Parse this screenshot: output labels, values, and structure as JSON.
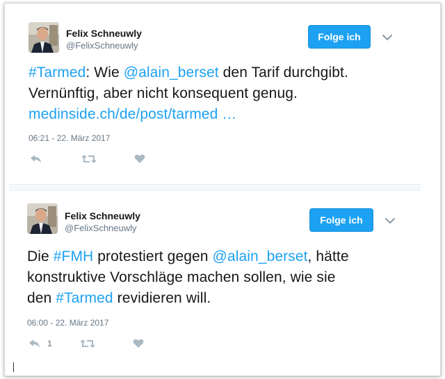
{
  "tweets": [
    {
      "user": {
        "name": "Felix Schneuwly",
        "handle": "@FelixSchneuwly",
        "avatar_icon": "profile-photo"
      },
      "follow_label": "Folge ich",
      "text_lines": [
        [
          {
            "t": "#Tarmed",
            "link": true
          },
          {
            "t": ": Wie ",
            "link": false
          },
          {
            "t": "@alain_berset",
            "link": true
          },
          {
            "t": " den Tarif durchgibt.",
            "link": false
          }
        ],
        [
          {
            "t": "Vernünftig, aber nicht konsequent genug.",
            "link": false
          }
        ],
        [
          {
            "t": " medinside.ch/de/post/tarmed  …",
            "link": true
          }
        ]
      ],
      "timestamp": "06:21 - 22. März 2017",
      "actions": {
        "reply_icon": "reply-icon",
        "retweet_icon": "retweet-icon",
        "like_icon": "heart-icon",
        "reply_count": ""
      }
    },
    {
      "user": {
        "name": "Felix Schneuwly",
        "handle": "@FelixSchneuwly",
        "avatar_icon": "profile-photo"
      },
      "follow_label": "Folge ich",
      "text_lines": [
        [
          {
            "t": "Die ",
            "link": false
          },
          {
            "t": "#FMH",
            "link": true
          },
          {
            "t": " protestiert gegen ",
            "link": false
          },
          {
            "t": "@alain_berset",
            "link": true
          },
          {
            "t": ", hätte",
            "link": false
          }
        ],
        [
          {
            "t": "konstruktive Vorschläge machen sollen, wie sie",
            "link": false
          }
        ],
        [
          {
            "t": "den ",
            "link": false
          },
          {
            "t": "#Tarmed",
            "link": true
          },
          {
            "t": " revidieren will.",
            "link": false
          }
        ]
      ],
      "timestamp": "06:00 - 22. März 2017",
      "actions": {
        "reply_icon": "reply-icon",
        "retweet_icon": "retweet-icon",
        "like_icon": "heart-icon",
        "reply_count": "1"
      }
    }
  ],
  "colors": {
    "link": "#1da1f2",
    "follow_bg": "#1da1f2",
    "action_icon": "#aab8c2",
    "meta_text": "#657786"
  }
}
